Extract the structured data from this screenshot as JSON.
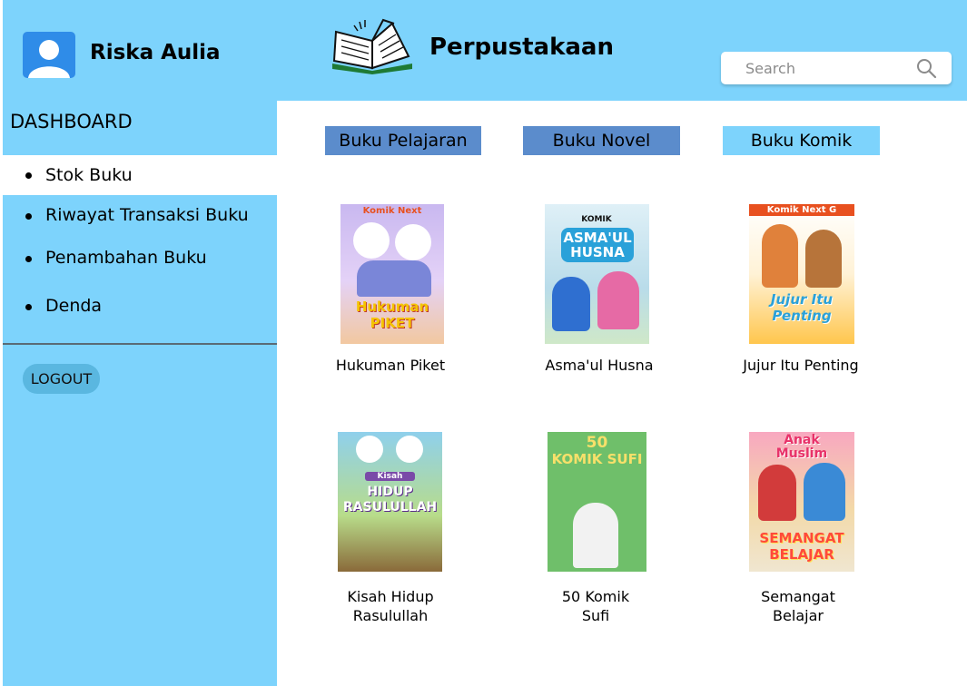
{
  "user": {
    "name": "Riska Aulia"
  },
  "header": {
    "title": "Perpustakaan"
  },
  "search": {
    "placeholder": "Search"
  },
  "sidebar": {
    "heading": "DASHBOARD",
    "items": [
      {
        "label": "Stok Buku",
        "active": true
      },
      {
        "label": "Riwayat Transaksi Buku",
        "active": false
      },
      {
        "label": "Penambahan Buku",
        "active": false
      },
      {
        "label": "Denda",
        "active": false
      }
    ],
    "logout_label": "LOGOUT"
  },
  "categories": [
    {
      "label": "Buku Pelajaran",
      "color": "#5b8ccc"
    },
    {
      "label": "Buku Novel",
      "color": "#5b8ccc"
    },
    {
      "label": "Buku Komik",
      "color": "#7dd3fc"
    }
  ],
  "books": [
    {
      "title": "Hukuman Piket",
      "cover": {
        "top_text": "Komik Next",
        "main_text": "Hukuman PIKET"
      }
    },
    {
      "title": "Asma'ul Husna",
      "cover": {
        "top_text": "KOMIK",
        "main_text": "ASMA'UL HUSNA"
      }
    },
    {
      "title": "Jujur Itu Penting",
      "cover": {
        "top_text": "Komik Next G",
        "main_text": "Jujur Itu Penting"
      }
    },
    {
      "title": "Kisah Hidup\nRasulullah",
      "cover": {
        "top_text": "Kisah",
        "main_text": "HIDUP RASULULLAH"
      }
    },
    {
      "title": "50 Komik\nSufi",
      "cover": {
        "top_text": "50",
        "main_text": "KOMIK SUFI"
      }
    },
    {
      "title": "Semangat\nBelajar",
      "cover": {
        "top_text": "Anak Muslim",
        "main_text": "SEMANGAT BELAJAR"
      }
    }
  ],
  "colors": {
    "primary": "#7dd3fc",
    "avatar": "#2f8ce8",
    "tab_selected": "#5b8ccc",
    "logout": "#5ab7e0"
  },
  "icons": {
    "avatar": "user-icon",
    "logo": "open-book-icon",
    "search": "magnifier-icon"
  }
}
